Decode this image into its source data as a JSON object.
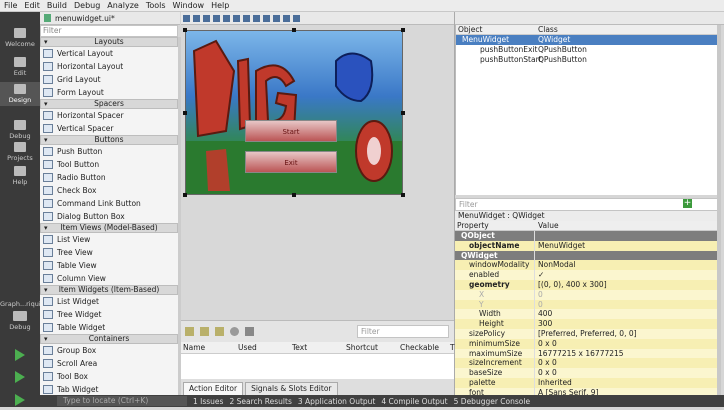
{
  "menu": [
    "File",
    "Edit",
    "Build",
    "Debug",
    "Analyze",
    "Tools",
    "Window",
    "Help"
  ],
  "modes": [
    {
      "label": "Welcome",
      "active": false
    },
    {
      "label": "Edit",
      "active": false
    },
    {
      "label": "Design",
      "active": true
    },
    {
      "label": "Debug",
      "active": false
    },
    {
      "label": "Projects",
      "active": false
    },
    {
      "label": "Help",
      "active": false
    }
  ],
  "target": {
    "project": "Graph...riqui",
    "config": "Debug"
  },
  "editor": {
    "file": "menuwidget.ui*"
  },
  "widgetbox": {
    "filter_placeholder": "Filter",
    "categories": [
      {
        "name": "Layouts",
        "items": [
          "Vertical Layout",
          "Horizontal Layout",
          "Grid Layout",
          "Form Layout"
        ]
      },
      {
        "name": "Spacers",
        "items": [
          "Horizontal Spacer",
          "Vertical Spacer"
        ]
      },
      {
        "name": "Buttons",
        "items": [
          "Push Button",
          "Tool Button",
          "Radio Button",
          "Check Box",
          "Command Link Button",
          "Dialog Button Box"
        ]
      },
      {
        "name": "Item Views (Model-Based)",
        "items": [
          "List View",
          "Tree View",
          "Table View",
          "Column View"
        ]
      },
      {
        "name": "Item Widgets (Item-Based)",
        "items": [
          "List Widget",
          "Tree Widget",
          "Table Widget"
        ]
      },
      {
        "name": "Containers",
        "items": [
          "Group Box",
          "Scroll Area",
          "Tool Box",
          "Tab Widget"
        ]
      }
    ]
  },
  "form": {
    "button_start": "Start",
    "button_exit": "Exit"
  },
  "actions": {
    "filter_placeholder": "Filter",
    "columns": [
      "Name",
      "Used",
      "Text",
      "Shortcut",
      "Checkable",
      "T"
    ],
    "tabs": [
      "Action Editor",
      "Signals & Slots Editor"
    ]
  },
  "object_inspector": {
    "columns": [
      "Object",
      "Class"
    ],
    "rows": [
      {
        "object": "MenuWidget",
        "class": "QWidget",
        "level": 0
      },
      {
        "object": "pushButtonExit",
        "class": "QPushButton",
        "level": 1
      },
      {
        "object": "pushButtonStart",
        "class": "QPushButton",
        "level": 1
      }
    ]
  },
  "property_editor": {
    "filter_placeholder": "Filter",
    "class_line": "MenuWidget : QWidget",
    "columns": [
      "Property",
      "Value"
    ],
    "rows": [
      {
        "kind": "sec",
        "name": "QObject",
        "value": ""
      },
      {
        "kind": "b",
        "name": "objectName",
        "value": "MenuWidget"
      },
      {
        "kind": "sec",
        "name": "QWidget",
        "value": ""
      },
      {
        "kind": "n",
        "name": "windowModality",
        "value": "NonModal"
      },
      {
        "kind": "n",
        "name": "enabled",
        "value": "✓"
      },
      {
        "kind": "b",
        "name": "geometry",
        "value": "[(0, 0), 400 x 300]"
      },
      {
        "kind": "dim",
        "name": "X",
        "value": "0"
      },
      {
        "kind": "dim",
        "name": "Y",
        "value": "0"
      },
      {
        "kind": "sub",
        "name": "Width",
        "value": "400"
      },
      {
        "kind": "sub",
        "name": "Height",
        "value": "300"
      },
      {
        "kind": "n",
        "name": "sizePolicy",
        "value": "[Preferred, Preferred, 0, 0]"
      },
      {
        "kind": "n",
        "name": "minimumSize",
        "value": "0 x 0"
      },
      {
        "kind": "n",
        "name": "maximumSize",
        "value": "16777215 x 16777215"
      },
      {
        "kind": "n",
        "name": "sizeIncrement",
        "value": "0 x 0"
      },
      {
        "kind": "n",
        "name": "baseSize",
        "value": "0 x 0"
      },
      {
        "kind": "n",
        "name": "palette",
        "value": "Inherited"
      },
      {
        "kind": "n",
        "name": "font",
        "value": "A  [Sans Serif, 9]"
      }
    ]
  },
  "statusbar": {
    "locate_placeholder": "Type to locate (Ctrl+K)",
    "panes": [
      "1 Issues",
      "2 Search Results",
      "3 Application Output",
      "4 Compile Output",
      "5 Debugger Console"
    ]
  },
  "colors": {
    "accent": "#3c9a3c",
    "prop_bg": "#fbf6cf",
    "mode_bg": "#3a3a3a"
  }
}
